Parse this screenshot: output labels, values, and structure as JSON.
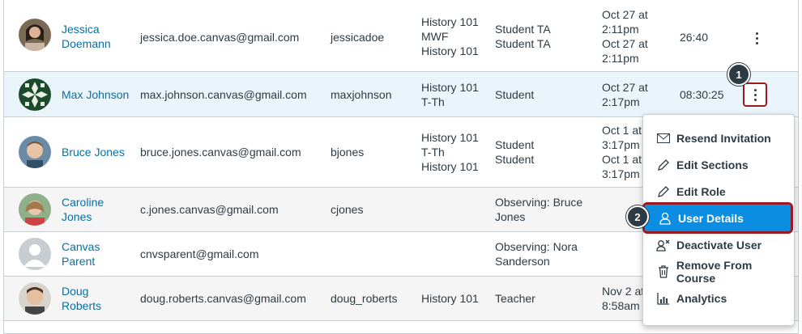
{
  "rows": [
    {
      "name": "Jessica Doemann",
      "name_lines": [
        "Jessica",
        "Doemann"
      ],
      "email": "jessica.doe.canvas@gmail.com",
      "login": "jessicadoe",
      "sections": [
        "History 101",
        "MWF",
        "History 101"
      ],
      "roles": [
        "Student TA",
        "Student TA"
      ],
      "last_activity": [
        "Oct 27 at",
        "2:11pm",
        "Oct 27 at",
        "2:11pm"
      ],
      "total_activity": "26:40"
    },
    {
      "name": "Max Johnson",
      "name_lines": [
        "Max Johnson"
      ],
      "email": "max.johnson.canvas@gmail.com",
      "login": "maxjohnson",
      "sections": [
        "History 101",
        "T-Th"
      ],
      "roles": [
        "Student"
      ],
      "last_activity": [
        "Oct 27 at",
        "2:17pm"
      ],
      "total_activity": "08:30:25"
    },
    {
      "name": "Bruce Jones",
      "name_lines": [
        "Bruce Jones"
      ],
      "email": "bruce.jones.canvas@gmail.com",
      "login": "bjones",
      "sections": [
        "History 101",
        "T-Th",
        "History 101"
      ],
      "roles": [
        "Student",
        "Student"
      ],
      "last_activity": [
        "Oct 1 at",
        "3:17pm",
        "Oct 1 at",
        "3:17pm"
      ],
      "total_activity": ""
    },
    {
      "name": "Caroline Jones",
      "name_lines": [
        "Caroline",
        "Jones"
      ],
      "email": "c.jones.canvas@gmail.com",
      "login": "cjones",
      "sections": [],
      "roles": [
        "Observing: Bruce",
        "Jones"
      ],
      "last_activity": [],
      "total_activity": ""
    },
    {
      "name": "Canvas Parent",
      "name_lines": [
        "Canvas",
        "Parent"
      ],
      "email": "cnvsparent@gmail.com",
      "login": "",
      "sections": [],
      "roles": [
        "Observing: Nora",
        "Sanderson"
      ],
      "last_activity": [],
      "total_activity": ""
    },
    {
      "name": "Doug Roberts",
      "name_lines": [
        "Doug",
        "Roberts"
      ],
      "email": "doug.roberts.canvas@gmail.com",
      "login": "doug_roberts",
      "sections": [
        "History 101"
      ],
      "roles": [
        "Teacher"
      ],
      "last_activity": [
        "Nov 2 at",
        "8:58am"
      ],
      "total_activity": ""
    }
  ],
  "callouts": {
    "one": "1",
    "two": "2"
  },
  "menu": {
    "items": [
      {
        "label": "Resend Invitation",
        "icon": "envelope-icon"
      },
      {
        "label": "Edit Sections",
        "icon": "pencil-icon"
      },
      {
        "label": "Edit Role",
        "icon": "pencil-icon"
      },
      {
        "label": "User Details",
        "icon": "user-icon",
        "highlighted": true
      },
      {
        "label": "Deactivate User",
        "icon": "user-remove-icon"
      },
      {
        "label": "Remove From Course",
        "icon": "trash-icon"
      },
      {
        "label": "Analytics",
        "icon": "analytics-icon"
      }
    ]
  },
  "colors": {
    "link": "#0770a3",
    "highlight": "#0b8ee1",
    "callout_border": "#9a1a20",
    "text": "#2d3b45"
  }
}
